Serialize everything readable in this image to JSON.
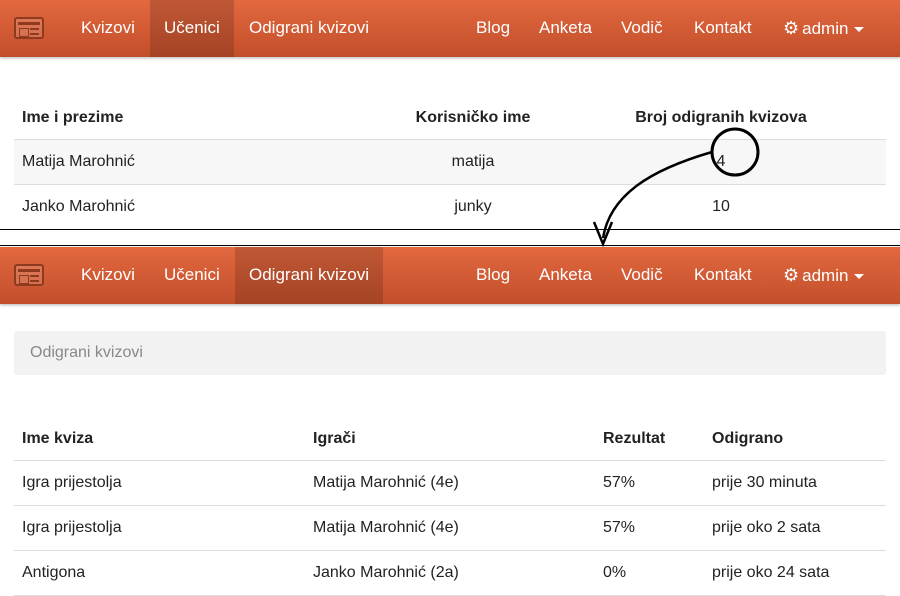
{
  "nav": {
    "items_left": [
      "Kvizovi",
      "Učenici",
      "Odigrani kvizovi"
    ],
    "items_right": [
      "Blog",
      "Anketa",
      "Vodič",
      "Kontakt"
    ],
    "admin_label": "admin",
    "top_active": "Učenici",
    "bottom_active": "Odigrani kvizovi"
  },
  "students": {
    "headers": [
      "Ime i prezime",
      "Korisničko ime",
      "Broj odigranih kvizova"
    ],
    "rows": [
      {
        "name": "Matija Marohnić",
        "username": "matija",
        "count": "4"
      },
      {
        "name": "Janko Marohnić",
        "username": "junky",
        "count": "10"
      }
    ]
  },
  "played": {
    "panel_title": "Odigrani kvizovi",
    "headers": [
      "Ime kviza",
      "Igrači",
      "Rezultat",
      "Odigrano"
    ],
    "rows": [
      {
        "quiz": "Igra prijestolja",
        "players": "Matija Marohnić (4e)",
        "result": "57%",
        "played": "prije 30 minuta"
      },
      {
        "quiz": "Igra prijestolja",
        "players": "Matija Marohnić (4e)",
        "result": "57%",
        "played": "prije oko 2 sata"
      },
      {
        "quiz": "Antigona",
        "players": "Janko Marohnić (2a)",
        "result": "0%",
        "played": "prije oko 24 sata"
      }
    ]
  },
  "colors": {
    "accent": "#d9572e",
    "navbar": "#d35a33"
  }
}
